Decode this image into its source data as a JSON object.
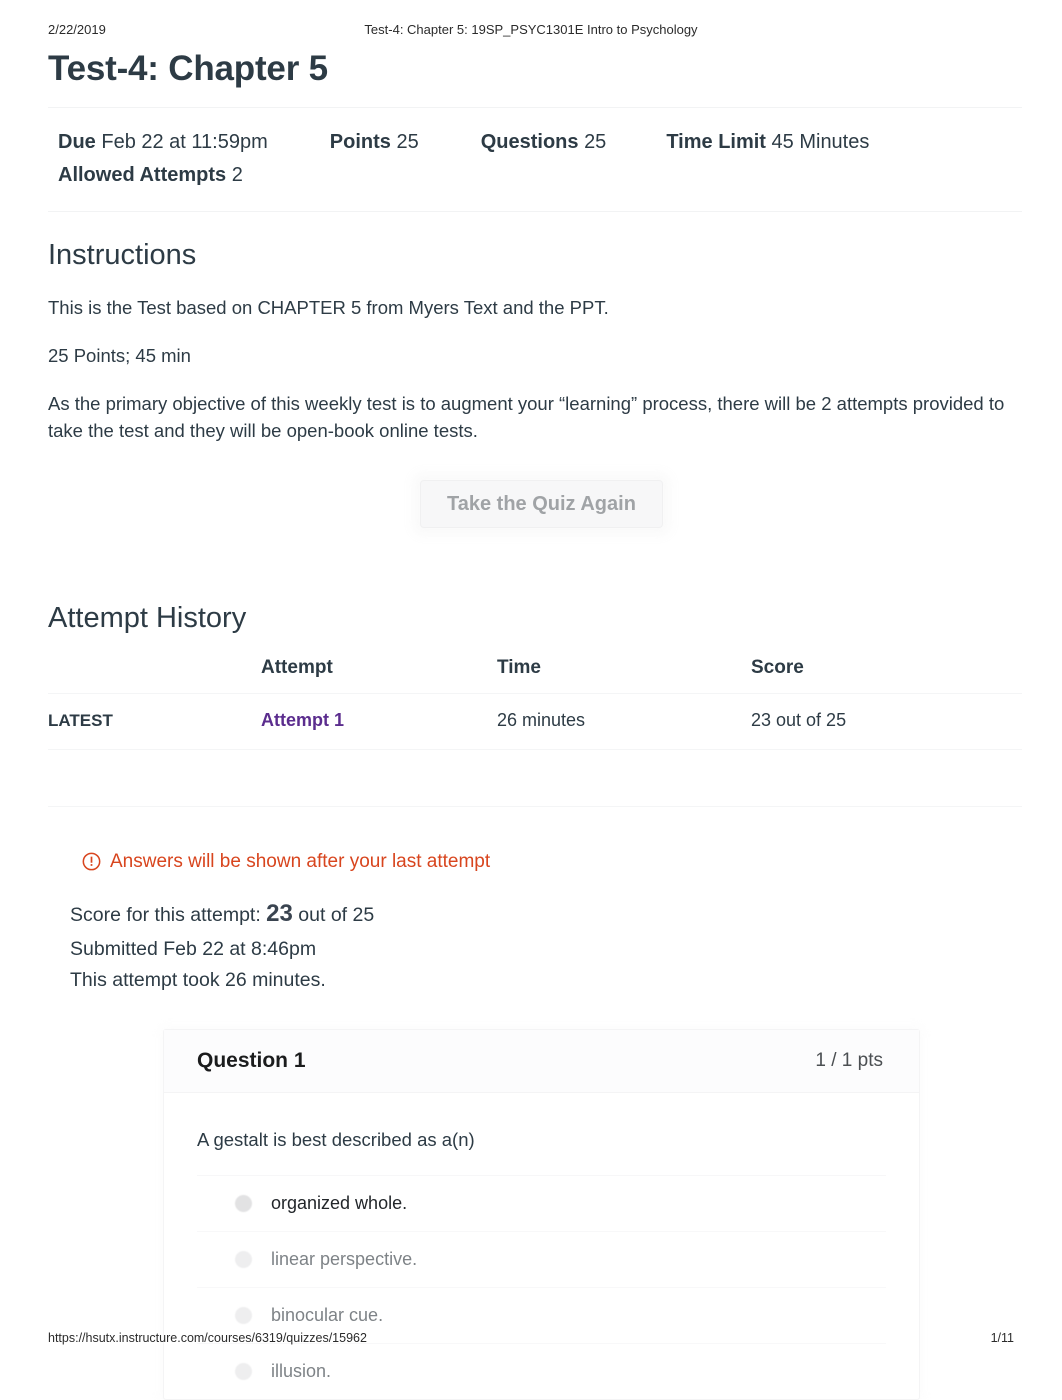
{
  "print": {
    "date": "2/22/2019",
    "doc_title": "Test-4: Chapter 5: 19SP_PSYC1301E Intro to Psychology",
    "url": "https://hsutx.instructure.com/courses/6319/quizzes/15962",
    "page_number": "1/11"
  },
  "quiz": {
    "title": "Test-4: Chapter 5",
    "meta": {
      "due_label": "Due",
      "due_value": "Feb 22 at 11:59pm",
      "points_label": "Points",
      "points_value": "25",
      "questions_label": "Questions",
      "questions_value": "25",
      "time_limit_label": "Time Limit",
      "time_limit_value": "45 Minutes",
      "allowed_attempts_label": "Allowed Attempts",
      "allowed_attempts_value": "2"
    }
  },
  "instructions": {
    "heading": "Instructions",
    "paragraphs": [
      "This is the Test based on CHAPTER 5 from Myers Text and the PPT.",
      "25 Points; 45 min",
      "As the primary objective of this weekly test is to augment your “learning” process, there will be 2 attempts provided to take the test and they will be open-book online tests."
    ]
  },
  "actions": {
    "take_quiz_again": "Take the Quiz Again"
  },
  "attempt_history": {
    "heading": "Attempt History",
    "columns": [
      "",
      "Attempt",
      "Time",
      "Score"
    ],
    "rows": [
      {
        "flag": "LATEST",
        "attempt": "Attempt 1",
        "time": "26 minutes",
        "score": "23 out of 25"
      }
    ]
  },
  "attempt_detail": {
    "notice": "Answers will be shown after your last attempt",
    "notice_icon": "warning-circle-icon",
    "score_prefix": "Score for this attempt:",
    "score_value": "23",
    "score_suffix": "out of 25",
    "submitted": "Submitted Feb 22 at 8:46pm",
    "duration": "This attempt took 26 minutes."
  },
  "question": {
    "name": "Question 1",
    "points": "1 / 1 pts",
    "text": "A gestalt is best described as a(n)",
    "answers": [
      {
        "label": "organized whole.",
        "selected": true
      },
      {
        "label": "linear perspective.",
        "selected": false
      },
      {
        "label": "binocular cue.",
        "selected": false
      },
      {
        "label": "illusion.",
        "selected": false
      }
    ]
  },
  "colors": {
    "link_purple": "#5b2d8e",
    "warning_orange": "#d8451e",
    "text": "#2d3b45"
  }
}
